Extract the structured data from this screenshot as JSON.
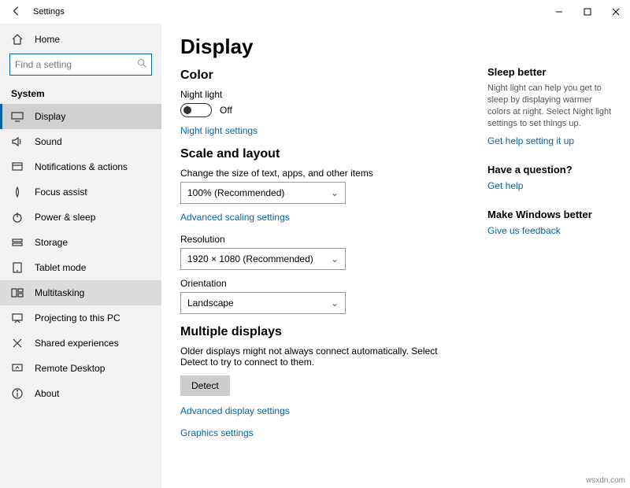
{
  "titlebar": {
    "title": "Settings"
  },
  "home_label": "Home",
  "search": {
    "placeholder": "Find a setting"
  },
  "group_label": "System",
  "nav": [
    {
      "label": "Display"
    },
    {
      "label": "Sound"
    },
    {
      "label": "Notifications & actions"
    },
    {
      "label": "Focus assist"
    },
    {
      "label": "Power & sleep"
    },
    {
      "label": "Storage"
    },
    {
      "label": "Tablet mode"
    },
    {
      "label": "Multitasking"
    },
    {
      "label": "Projecting to this PC"
    },
    {
      "label": "Shared experiences"
    },
    {
      "label": "Remote Desktop"
    },
    {
      "label": "About"
    }
  ],
  "page": {
    "title": "Display",
    "color": {
      "heading": "Color",
      "night_light_label": "Night light",
      "toggle_state": "Off",
      "night_light_link": "Night light settings"
    },
    "scale": {
      "heading": "Scale and layout",
      "size_label": "Change the size of text, apps, and other items",
      "size_value": "100% (Recommended)",
      "advanced_link": "Advanced scaling settings",
      "resolution_label": "Resolution",
      "resolution_value": "1920 × 1080 (Recommended)",
      "orientation_label": "Orientation",
      "orientation_value": "Landscape"
    },
    "multi": {
      "heading": "Multiple displays",
      "desc": "Older displays might not always connect automatically. Select Detect to try to connect to them.",
      "detect": "Detect",
      "adv_link": "Advanced display settings",
      "gfx_link": "Graphics settings"
    }
  },
  "right": {
    "sleep": {
      "heading": "Sleep better",
      "desc": "Night light can help you get to sleep by displaying warmer colors at night. Select Night light settings to set things up.",
      "link": "Get help setting it up"
    },
    "question": {
      "heading": "Have a question?",
      "link": "Get help"
    },
    "better": {
      "heading": "Make Windows better",
      "link": "Give us feedback"
    }
  },
  "watermark": "wsxdn.com"
}
